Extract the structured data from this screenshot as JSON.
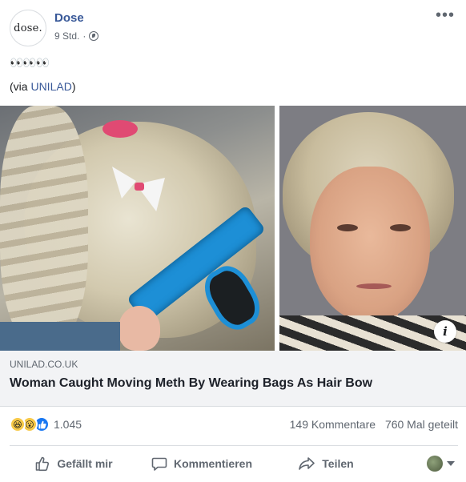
{
  "post": {
    "page_name": "Dose",
    "avatar_text": "dose.",
    "time": "9 Std.",
    "separator": "·",
    "emoji_text": "👀👀👀",
    "via_prefix": "(via ",
    "via_link": "UNILAD",
    "via_suffix": ")"
  },
  "link_preview": {
    "domain": "UNILAD.CO.UK",
    "headline": "Woman Caught Moving Meth By Wearing Bags As Hair Bow"
  },
  "stats": {
    "reaction_count": "1.045",
    "comments": "149 Kommentare",
    "shares": "760 Mal geteilt"
  },
  "actions": {
    "like": "Gefällt mir",
    "comment": "Kommentieren",
    "share": "Teilen"
  },
  "icons": [
    "globe-icon",
    "more-icon",
    "info-icon",
    "haha-reaction-icon",
    "wow-reaction-icon",
    "like-reaction-icon",
    "like-icon",
    "comment-icon",
    "share-icon",
    "caret-down-icon"
  ],
  "colors": {
    "link": "#385898",
    "secondary_text": "#606770",
    "like_blue": "#1877f2",
    "reaction_yellow": "#f7c948"
  }
}
